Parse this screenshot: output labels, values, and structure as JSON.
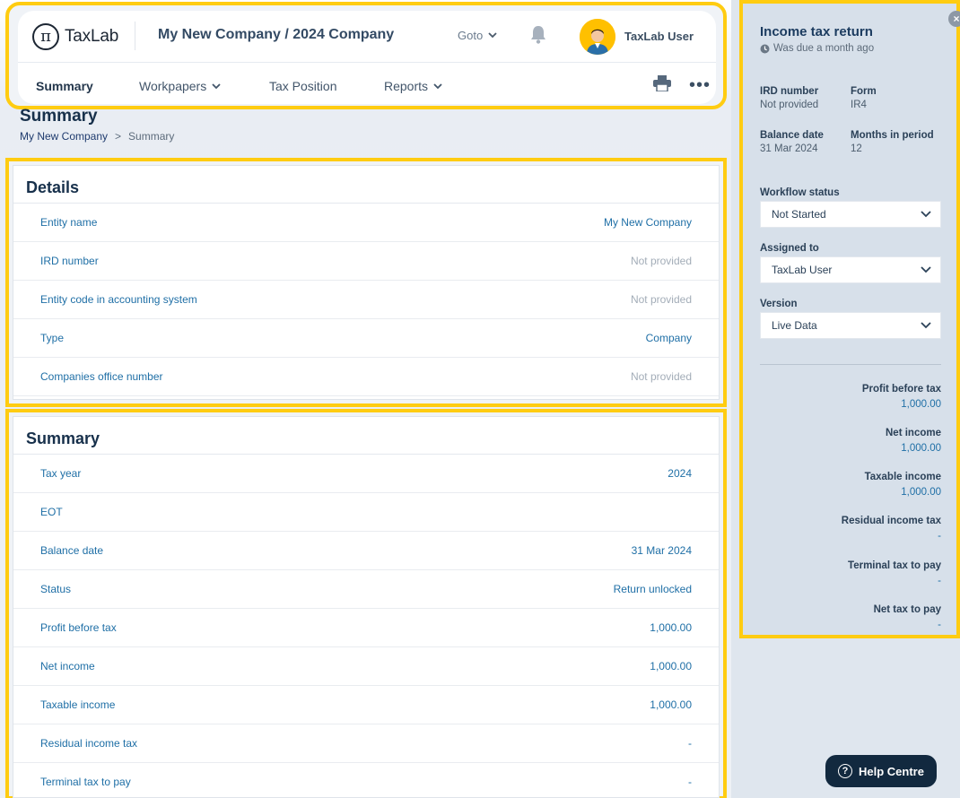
{
  "header": {
    "logo_text": "TaxLab",
    "logo_symbol": "π",
    "company_path": "My New Company / 2024 Company",
    "goto_label": "Goto",
    "user_name": "TaxLab User"
  },
  "nav": {
    "items": [
      {
        "label": "Summary"
      },
      {
        "label": "Workpapers"
      },
      {
        "label": "Tax Position"
      },
      {
        "label": "Reports"
      }
    ],
    "more_label": "•••"
  },
  "page": {
    "title": "Summary",
    "breadcrumb": {
      "root": "My New Company",
      "separator": ">",
      "current": "Summary"
    }
  },
  "details": {
    "title": "Details",
    "rows": [
      {
        "label": "Entity name",
        "value": "My New Company"
      },
      {
        "label": "IRD number",
        "value": "Not provided"
      },
      {
        "label": "Entity code in accounting system",
        "value": "Not provided"
      },
      {
        "label": "Type",
        "value": "Company"
      },
      {
        "label": "Companies office number",
        "value": "Not provided"
      }
    ]
  },
  "summary": {
    "title": "Summary",
    "rows": [
      {
        "label": "Tax year",
        "value": "2024"
      },
      {
        "label": "EOT",
        "value": ""
      },
      {
        "label": "Balance date",
        "value": "31 Mar 2024"
      },
      {
        "label": "Status",
        "value": "Return unlocked"
      },
      {
        "label": "Profit before tax",
        "value": "1,000.00"
      },
      {
        "label": "Net income",
        "value": "1,000.00"
      },
      {
        "label": "Taxable income",
        "value": "1,000.00"
      },
      {
        "label": "Residual income tax",
        "value": "-"
      },
      {
        "label": "Terminal tax to pay",
        "value": "-"
      }
    ]
  },
  "side": {
    "close_label": "×",
    "title": "Income tax return",
    "subtitle": "Was due a month ago",
    "ird_label": "IRD number",
    "ird_value": "Not provided",
    "form_label": "Form",
    "form_value": "IR4",
    "balance_label": "Balance date",
    "balance_value": "31 Mar 2024",
    "months_label": "Months in period",
    "months_value": "12",
    "workflow_label": "Workflow status",
    "workflow_value": "Not Started",
    "assigned_label": "Assigned to",
    "assigned_value": "TaxLab User",
    "version_label": "Version",
    "version_value": "Live Data",
    "metrics": [
      {
        "label": "Profit before tax",
        "value": "1,000.00"
      },
      {
        "label": "Net income",
        "value": "1,000.00"
      },
      {
        "label": "Taxable income",
        "value": "1,000.00"
      },
      {
        "label": "Residual income tax",
        "value": "-"
      },
      {
        "label": "Terminal tax to pay",
        "value": "-"
      },
      {
        "label": "Net tax to pay",
        "value": "-"
      }
    ]
  },
  "help": {
    "label": "Help Centre",
    "icon_text": "?"
  },
  "icons": [
    "bell-icon",
    "printer-icon",
    "chevron-down-icon",
    "clock-icon",
    "close-icon",
    "help-icon",
    "avatar"
  ],
  "colors": {
    "accent": "#1f6fa6",
    "highlight": "#ffcc11",
    "muted": "#a3adb8",
    "help_bg": "#12293f"
  }
}
